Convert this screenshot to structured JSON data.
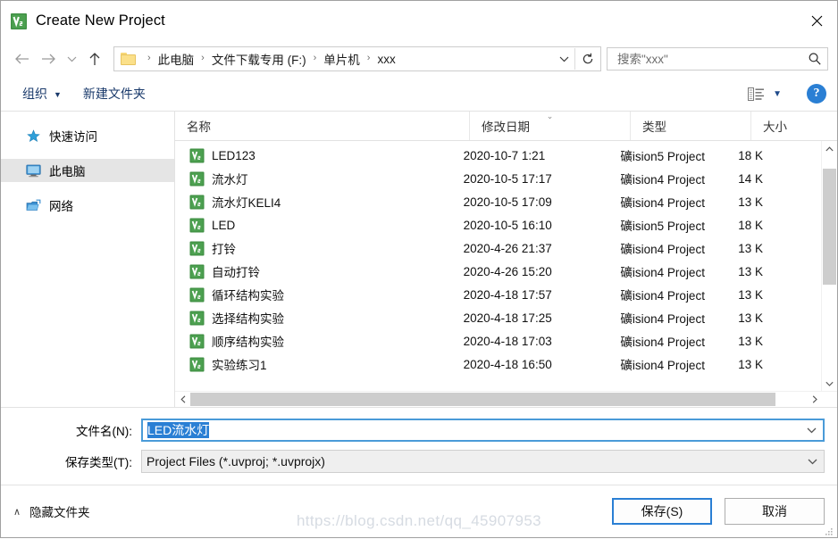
{
  "window": {
    "title": "Create New Project",
    "app_icon": "keil-uvision-icon",
    "close_label": "✕"
  },
  "nav": {
    "back_icon": "arrow-left-icon",
    "forward_icon": "arrow-right-icon",
    "recent_icon": "chevron-down-icon",
    "up_icon": "arrow-up-icon",
    "folder_icon": "folder-icon",
    "breadcrumbs": [
      "此电脑",
      "文件下载专用 (F:)",
      "单片机",
      "xxx"
    ],
    "separator": "›",
    "dropdown_icon": "chevron-down-icon",
    "refresh_icon": "refresh-icon"
  },
  "search": {
    "placeholder": "搜索\"xxx\"",
    "value": "",
    "icon": "search-icon"
  },
  "toolbar": {
    "organize_label": "组织",
    "organize_caret": "▼",
    "new_folder_label": "新建文件夹",
    "view_icon": "list-view-icon",
    "view_caret": "▼",
    "help_label": "?"
  },
  "sidebar": {
    "items": [
      {
        "label": "快速访问",
        "icon": "star-icon",
        "selected": false
      },
      {
        "label": "此电脑",
        "icon": "computer-icon",
        "selected": true
      },
      {
        "label": "网络",
        "icon": "network-icon",
        "selected": false
      }
    ]
  },
  "filelist": {
    "columns": [
      {
        "label": "名称",
        "sorted": false
      },
      {
        "label": "修改日期",
        "sorted": true,
        "sort_mark": "⌄"
      },
      {
        "label": "类型",
        "sorted": false
      },
      {
        "label": "大小",
        "sorted": false
      }
    ],
    "rows": [
      {
        "name": "LED123",
        "date": "2020-10-7 1:21",
        "type": "礦ision5 Project",
        "size": "18 K",
        "icon": "uvision-file-icon"
      },
      {
        "name": "流水灯",
        "date": "2020-10-5 17:17",
        "type": "礦ision4 Project",
        "size": "14 K",
        "icon": "uvision-file-icon"
      },
      {
        "name": "流水灯KELI4",
        "date": "2020-10-5 17:09",
        "type": "礦ision4 Project",
        "size": "13 K",
        "icon": "uvision-file-icon"
      },
      {
        "name": "LED",
        "date": "2020-10-5 16:10",
        "type": "礦ision5 Project",
        "size": "18 K",
        "icon": "uvision-file-icon"
      },
      {
        "name": "打铃",
        "date": "2020-4-26 21:37",
        "type": "礦ision4 Project",
        "size": "13 K",
        "icon": "uvision-file-icon"
      },
      {
        "name": "自动打铃",
        "date": "2020-4-26 15:20",
        "type": "礦ision4 Project",
        "size": "13 K",
        "icon": "uvision-file-icon"
      },
      {
        "name": "循环结构实验",
        "date": "2020-4-18 17:57",
        "type": "礦ision4 Project",
        "size": "13 K",
        "icon": "uvision-file-icon"
      },
      {
        "name": "选择结构实验",
        "date": "2020-4-18 17:25",
        "type": "礦ision4 Project",
        "size": "13 K",
        "icon": "uvision-file-icon"
      },
      {
        "name": "顺序结构实验",
        "date": "2020-4-18 17:03",
        "type": "礦ision4 Project",
        "size": "13 K",
        "icon": "uvision-file-icon"
      },
      {
        "name": "实验练习1",
        "date": "2020-4-18 16:50",
        "type": "礦ision4 Project",
        "size": "13 K",
        "icon": "uvision-file-icon"
      }
    ],
    "scroll_up_icon": "chevron-up-icon",
    "scroll_down_icon": "chevron-down-icon",
    "scroll_left_icon": "chevron-left-icon",
    "scroll_right_icon": "chevron-right-icon"
  },
  "form": {
    "filename_label": "文件名(N):",
    "filename_value": "LED流水灯",
    "filetype_label": "保存类型(T):",
    "filetype_value": "Project Files (*.uvproj; *.uvprojx)",
    "combo_arrow": "chevron-down-icon"
  },
  "footer": {
    "hide_folders_label": "隐藏文件夹",
    "hide_folders_caret": "∧",
    "save_label": "保存(S)",
    "cancel_label": "取消",
    "watermark": "https://blog.csdn.net/qq_45907953"
  },
  "colors": {
    "accent": "#2a7fd4",
    "selection": "#2a7fd4",
    "sidebar_selected": "#e5e5e5",
    "link": "#1a3a6b",
    "scrollbar_thumb": "#cdcdcd"
  }
}
